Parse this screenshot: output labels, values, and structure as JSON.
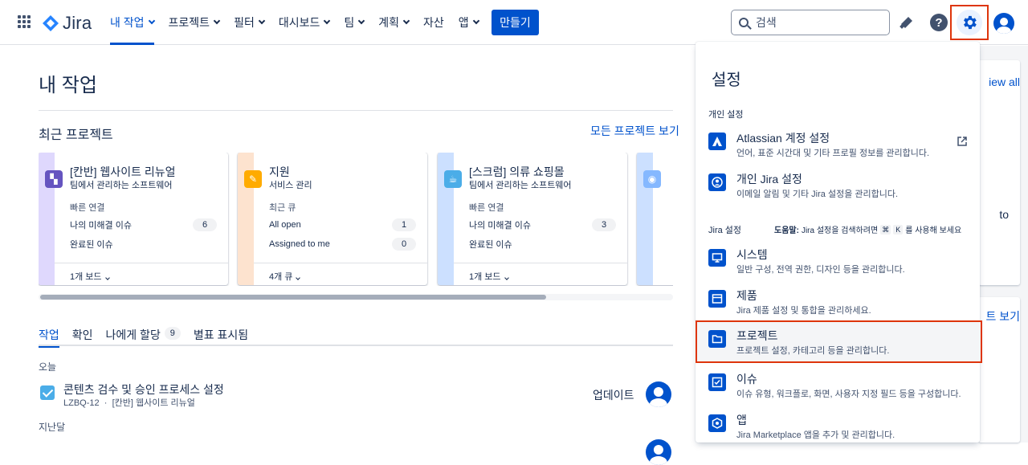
{
  "app": {
    "name": "Jira"
  },
  "nav": [
    {
      "label": "내 작업",
      "active": true,
      "dropdown": true
    },
    {
      "label": "프로젝트",
      "dropdown": true
    },
    {
      "label": "필터",
      "dropdown": true
    },
    {
      "label": "대시보드",
      "dropdown": true
    },
    {
      "label": "팀",
      "dropdown": true
    },
    {
      "label": "계획",
      "dropdown": true
    },
    {
      "label": "자산",
      "dropdown": false
    },
    {
      "label": "앱",
      "dropdown": true
    }
  ],
  "create_label": "만들기",
  "search": {
    "placeholder": "검색"
  },
  "page": {
    "title": "내 작업",
    "recent_title": "최근 프로젝트",
    "view_all": "모든 프로젝트 보기"
  },
  "cards": [
    {
      "name": "[칸반] 웹사이트 리뉴얼",
      "sub": "팀에서 관리하는 소프트웨어",
      "links_header": "빠른 연결",
      "rows": [
        {
          "label": "나의 미해결 이슈",
          "count": "6"
        },
        {
          "label": "완료된 이슈",
          "count": ""
        }
      ],
      "footer": "1개 보드"
    },
    {
      "name": "지원",
      "sub": "서비스 관리",
      "links_header": "최근 큐",
      "rows": [
        {
          "label": "All open",
          "count": "1"
        },
        {
          "label": "Assigned to me",
          "count": "0"
        }
      ],
      "footer": "4개 큐"
    },
    {
      "name": "[스크럼] 의류 쇼핑몰",
      "sub": "팀에서 관리하는 소프트웨어",
      "links_header": "빠른 연결",
      "rows": [
        {
          "label": "나의 미해결 이슈",
          "count": "3"
        },
        {
          "label": "완료된 이슈",
          "count": ""
        }
      ],
      "footer": "1개 보드"
    }
  ],
  "tabs": [
    {
      "label": "작업",
      "active": true
    },
    {
      "label": "확인"
    },
    {
      "label": "나에게 할당",
      "badge": "9"
    },
    {
      "label": "별표 표시됨"
    }
  ],
  "groups": {
    "today": "오늘",
    "last_month": "지난달"
  },
  "task": {
    "title": "콘텐츠 검수 및 승인 프로세스 설정",
    "key": "LZBQ-12",
    "sep": "·",
    "project": "[칸반] 웹사이트 리뉴얼",
    "status": "업데이트"
  },
  "background": {
    "view_all_fragment": "iew all",
    "to_fragment": "to",
    "view_fragment": "트 보기"
  },
  "settings": {
    "title": "설정",
    "personal_header": "개인 설정",
    "personal_items": [
      {
        "name": "Atlassian 계정 설정",
        "desc": "언어, 표준 시간대 및 기타 프로필 정보를 관리합니다.",
        "icon": "atlassian-icon",
        "external": true
      },
      {
        "name": "개인 Jira 설정",
        "desc": "이메일 알림 및 기타 Jira 설정을 관리합니다.",
        "icon": "person-settings-icon"
      }
    ],
    "jira_header": "Jira 설정",
    "help_prefix": "도움말:",
    "help_text": "Jira 설정을 검색하려면",
    "help_key1": "⌘",
    "help_key2": "K",
    "help_suffix": "를 사용해 보세요",
    "jira_items": [
      {
        "name": "시스템",
        "desc": "일반 구성, 전역 권한, 디자인 등을 관리합니다.",
        "icon": "monitor-icon"
      },
      {
        "name": "제품",
        "desc": "Jira 제품 설정 및 통합을 관리하세요.",
        "icon": "window-icon"
      },
      {
        "name": "프로젝트",
        "desc": "프로젝트 설정, 카테고리 등을 관리합니다.",
        "icon": "folder-icon",
        "selected": true
      },
      {
        "name": "이슈",
        "desc": "이슈 유형, 워크플로, 화면, 사용자 지정 필드 등을 구성합니다.",
        "icon": "issue-icon"
      },
      {
        "name": "앱",
        "desc": "Jira Marketplace 앱을 추가 및 관리합니다.",
        "icon": "app-icon"
      }
    ]
  },
  "colors": {
    "brand": "#0052cc",
    "highlight": "#de350b"
  }
}
